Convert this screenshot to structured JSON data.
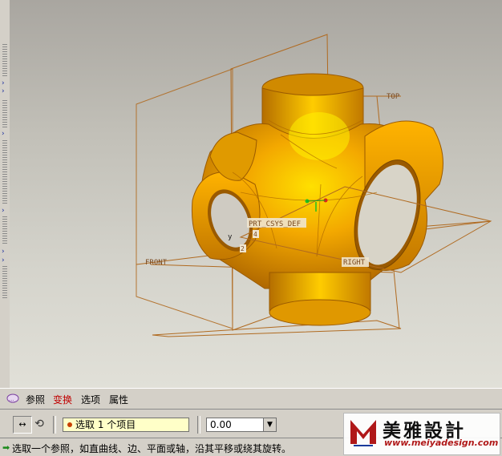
{
  "viewport": {
    "datum_planes": [
      "TOP",
      "FRONT",
      "RIGHT"
    ],
    "csys_label": "PRT_CSYS_DEF",
    "axis_labels": {
      "y": "y",
      "marker1": "4",
      "marker2": "2"
    },
    "colors": {
      "model": "#f0a000",
      "model_shadow": "#b06a00",
      "datum": "#b06a20"
    }
  },
  "tabs": {
    "items": [
      {
        "label": "参照",
        "active": false
      },
      {
        "label": "变换",
        "active": true
      },
      {
        "label": "选项",
        "active": false
      },
      {
        "label": "属性",
        "active": false
      }
    ]
  },
  "dashboard": {
    "move_icon": "move-arrows-icon",
    "rotate_icon": "rotate-icon",
    "collector_text": "选取 1 个项目",
    "value": "0.00"
  },
  "status": {
    "message": "选取一个参照，如直曲线、边、平面或轴，沿其平移或绕其旋转。"
  },
  "logo": {
    "name": "美雅設計",
    "url": "www.meiyadesign.com",
    "mark_letter": "M"
  }
}
